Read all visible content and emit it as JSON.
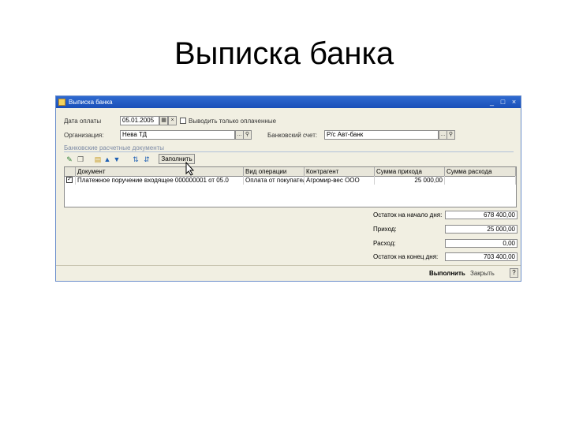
{
  "slide": {
    "title": "Выписка банка"
  },
  "window": {
    "title": "Выписка банка",
    "controls": {
      "minimize": "_",
      "maximize": "□",
      "close": "×"
    }
  },
  "form": {
    "payment_date_label": "Дата оплаты",
    "payment_date_value": "05.01.2005",
    "only_paid_label": "Выводить только оплаченные",
    "organization_label": "Организация:",
    "organization_value": "Нева ТД",
    "bank_account_label": "Банковский счет:",
    "bank_account_value": "Р/с Авт-банк"
  },
  "section": {
    "title": "Банковские расчетные документы"
  },
  "toolbar": {
    "fill_button": "Заполнить"
  },
  "table": {
    "columns": [
      "Документ",
      "Вид операции",
      "Контрагент",
      "Сумма прихода",
      "Сумма расхода"
    ],
    "rows": [
      {
        "document": "Платежное поручение входящее 000000001 от 05.0",
        "operation": "Оплата от покупателя",
        "counterparty": "Агромир-вес ООО",
        "income": "25 000,00",
        "expense": ""
      }
    ]
  },
  "totals": [
    {
      "label": "Остаток на начало дня:",
      "value": "678 400,00"
    },
    {
      "label": "Приход:",
      "value": "25 000,00"
    },
    {
      "label": "Расход:",
      "value": "0,00"
    },
    {
      "label": "Остаток на конец дня:",
      "value": "703 400,00"
    }
  ],
  "footer": {
    "execute": "Выполнить",
    "close": "Закрыть",
    "help": "?"
  },
  "colors": {
    "titlebar": "#1a4fb8",
    "window_bg": "#f1efe2"
  }
}
